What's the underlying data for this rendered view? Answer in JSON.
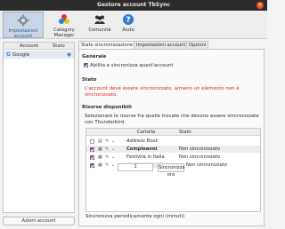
{
  "window": {
    "title": "Gestore account TbSync"
  },
  "toolbar": {
    "items": [
      {
        "label": "Impostazioni account",
        "icon": "settings-gear-icon",
        "active": true
      },
      {
        "label": "Category Manager",
        "icon": "category-color-wheel-icon",
        "active": false
      },
      {
        "label": "Comunità",
        "icon": "community-people-icon",
        "active": false
      },
      {
        "label": "Aiuto",
        "icon": "help-icon",
        "active": false
      }
    ]
  },
  "sidebar": {
    "headers": {
      "account": "Account",
      "stato": "Stato"
    },
    "accounts": [
      {
        "name": "Google",
        "icon": "google-g-icon",
        "status_icon": "diamond-status-icon"
      }
    ],
    "button_label": "Azioni account"
  },
  "tabs": [
    {
      "label": "Stato sincronizzazione",
      "active": true
    },
    {
      "label": "Impostazioni account",
      "active": false
    },
    {
      "label": "Opzioni",
      "active": false
    }
  ],
  "panel": {
    "generale": "Generale",
    "enable_label": "Abilita e sincronizza quest'account",
    "stato": "Stato",
    "stato_msg_line1": "L'account deve essere sincronizzato, almeno un elemento non è",
    "stato_msg_line2": "sincronizzato.",
    "risorse": "Risorse disponibili",
    "risorse_desc_line1": "Selezionare le risorse fra quelle trovate che devono essere sincronizzate",
    "risorse_desc_line2": "con Thunderbird.",
    "table": {
      "headers": {
        "cartella": "Cartella",
        "stato": "Stato"
      },
      "rows": [
        {
          "name": "Address Book",
          "status": "",
          "checked": false,
          "italic": true
        },
        {
          "name": "Compleanni",
          "status": "Non sincronizzato",
          "checked": true,
          "italic": false
        },
        {
          "name": "Festività in Italia",
          "status": "Non sincronizzato",
          "checked": true,
          "italic": false
        },
        {
          "name": "",
          "status": "Non sincronizzato",
          "checked": true,
          "italic": false
        }
      ]
    },
    "periodic_label": "Sincronizza periodicamente ogni (minuti)",
    "periodic_value": "1",
    "sync_now": "Sincronizza ora"
  },
  "colors": {
    "accent": "#8c5fa8",
    "error": "#d22222",
    "titlebar": "#2c2c2c"
  }
}
